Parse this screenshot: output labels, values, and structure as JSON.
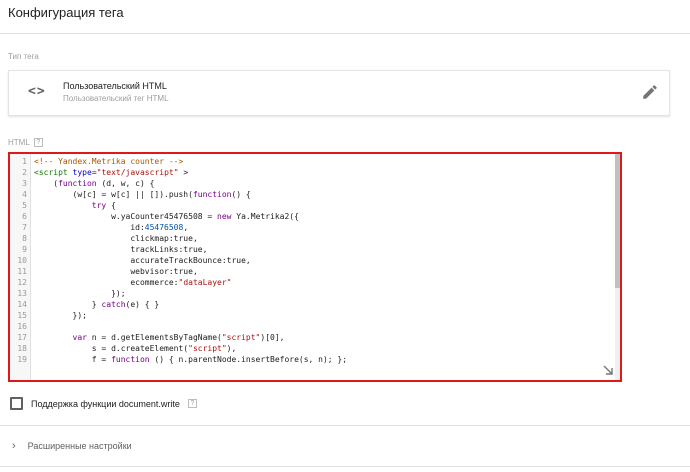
{
  "header": {
    "title": "Конфигурация тега"
  },
  "tag_type": {
    "section_label": "Тип тега",
    "icon": "code-brackets-icon",
    "name": "Пользовательский HTML",
    "description": "Пользовательский тег HTML",
    "edit_icon": "pencil-icon"
  },
  "html_section": {
    "label": "HTML",
    "help": "?",
    "lines": [
      {
        "n": "1",
        "text": "<!-- Yandex.Metrika counter -->"
      },
      {
        "n": "2",
        "text": "<script type=\"text/javascript\" >"
      },
      {
        "n": "3",
        "text": "    (function (d, w, c) {"
      },
      {
        "n": "4",
        "text": "        (w[c] = w[c] || []).push(function() {"
      },
      {
        "n": "5",
        "text": "            try {"
      },
      {
        "n": "6",
        "text": "                w.yaCounter45476508 = new Ya.Metrika2({"
      },
      {
        "n": "7",
        "text": "                    id:45476508,"
      },
      {
        "n": "8",
        "text": "                    clickmap:true,"
      },
      {
        "n": "9",
        "text": "                    trackLinks:true,"
      },
      {
        "n": "10",
        "text": "                    accurateTrackBounce:true,"
      },
      {
        "n": "11",
        "text": "                    webvisor:true,"
      },
      {
        "n": "12",
        "text": "                    ecommerce:\"dataLayer\""
      },
      {
        "n": "13",
        "text": "                });"
      },
      {
        "n": "14",
        "text": "            } catch(e) { }"
      },
      {
        "n": "15",
        "text": "        });"
      },
      {
        "n": "16",
        "text": ""
      },
      {
        "n": "17",
        "text": "        var n = d.getElementsByTagName(\"script\")[0],"
      },
      {
        "n": "18",
        "text": "            s = d.createElement(\"script\"),"
      },
      {
        "n": "19",
        "text": "            f = function () { n.parentNode.insertBefore(s, n); };"
      }
    ]
  },
  "document_write": {
    "label": "Поддержка функции document.write",
    "help": "?",
    "checked": false
  },
  "advanced": {
    "label": "Расширенные настройки",
    "chevron": "chevron-right-icon"
  },
  "colors": {
    "highlight_border": "#e01818",
    "comment": "#aa5500",
    "string": "#aa1111",
    "keyword": "#770088"
  }
}
